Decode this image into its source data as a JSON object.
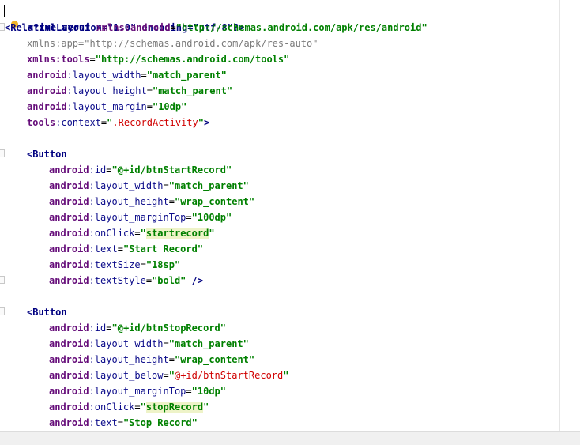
{
  "lines": [
    [
      "<?xml version=\"1.0\" encoding=\"utf-8\"?>"
    ],
    [
      "<",
      "RelativeLayout",
      " ",
      "xmlns:android",
      "=",
      "\"http://schemas.android.com/apk/res/android\""
    ],
    [
      "xmlns:app",
      "=",
      "\"http://schemas.android.com/apk/res-auto\""
    ],
    [
      "xmlns:tools",
      "=",
      "\"http://schemas.android.com/tools\""
    ],
    [
      "android",
      ":layout_width",
      "=",
      "\"match_parent\""
    ],
    [
      "android",
      ":layout_height",
      "=",
      "\"match_parent\""
    ],
    [
      "android",
      ":layout_margin",
      "=",
      "\"10dp\""
    ],
    [
      "tools",
      ":context",
      "=",
      "\"",
      ".RecordActivity",
      "\"",
      ">"
    ],
    [],
    [
      "<",
      "Button"
    ],
    [
      "android",
      ":id",
      "=",
      "\"@+id/btnStartRecord\""
    ],
    [
      "android",
      ":layout_width",
      "=",
      "\"match_parent\""
    ],
    [
      "android",
      ":layout_height",
      "=",
      "\"wrap_content\""
    ],
    [
      "android",
      ":layout_marginTop",
      "=",
      "\"100dp\""
    ],
    [
      "android",
      ":onClick",
      "=",
      "\"",
      "startrecord",
      "\""
    ],
    [
      "android",
      ":text",
      "=",
      "\"Start Record\""
    ],
    [
      "android",
      ":textSize",
      "=",
      "\"18sp\""
    ],
    [
      "android",
      ":textStyle",
      "=",
      "\"bold\"",
      " />"
    ],
    [],
    [
      "<",
      "Button"
    ],
    [
      "android",
      ":id",
      "=",
      "\"@+id/btnStopRecord\""
    ],
    [
      "android",
      ":layout_width",
      "=",
      "\"match_parent\""
    ],
    [
      "android",
      ":layout_height",
      "=",
      "\"wrap_content\""
    ],
    [
      "android",
      ":layout_below",
      "=",
      "\"",
      "@+id/btnStartRecord",
      "\""
    ],
    [
      "android",
      ":layout_marginTop",
      "=",
      "\"10dp\""
    ],
    [
      "android",
      ":onClick",
      "=",
      "\"",
      "stopRecord",
      "\""
    ],
    [
      "android",
      ":text",
      "=",
      "\"Stop Record\""
    ]
  ],
  "colors": {
    "tag": "#000080",
    "namespace": "#660e7a",
    "string": "#008000",
    "reference": "#d00000",
    "highlight": "#eef3c8",
    "intention_bulb": "#f0b429"
  },
  "icons": {
    "intention": "lightbulb-icon",
    "fold": "fold-marker-icon"
  }
}
